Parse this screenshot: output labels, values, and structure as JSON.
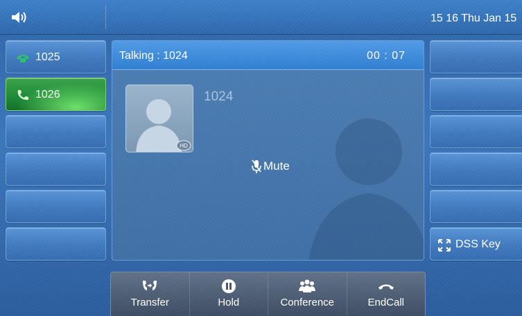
{
  "topbar": {
    "speaker_icon": "speaker-icon",
    "clock": "15 16 Thu Jan 15"
  },
  "line_keys": [
    {
      "label": "1025",
      "icon": "phone-icon",
      "state": "idle"
    },
    {
      "label": "1026",
      "icon": "handset-active-icon",
      "state": "active"
    },
    {
      "label": ""
    },
    {
      "label": ""
    },
    {
      "label": ""
    },
    {
      "label": ""
    }
  ],
  "call": {
    "status": "Talking : 1024",
    "timer": "00 : 07",
    "remote_number": "1024",
    "avatar_badge": "HD",
    "mute_label": "Mute"
  },
  "right_keys": [
    {
      "label": ""
    },
    {
      "label": ""
    },
    {
      "label": ""
    },
    {
      "label": ""
    },
    {
      "label": ""
    },
    {
      "label": "DSS Key",
      "icon": "expand-icon"
    }
  ],
  "softkeys": [
    {
      "label": "Transfer",
      "icon": "transfer-icon"
    },
    {
      "label": "Hold",
      "icon": "hold-icon"
    },
    {
      "label": "Conference",
      "icon": "conference-icon"
    },
    {
      "label": "EndCall",
      "icon": "end-call-icon"
    }
  ],
  "colors": {
    "background": "#3668ac",
    "active_key": "#1f8a38",
    "call_header": "#3b88d8",
    "softkey_bar": "#4a5a70"
  }
}
